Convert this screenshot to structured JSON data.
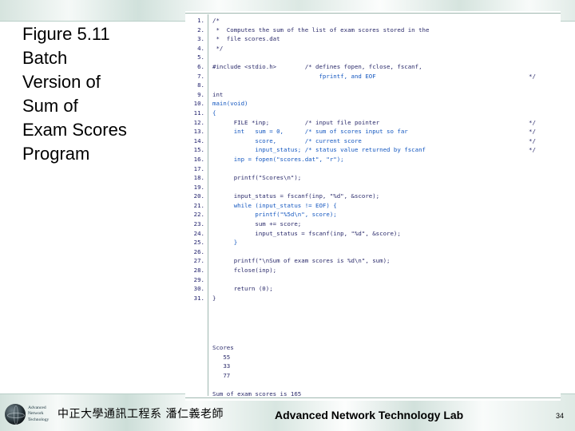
{
  "slide": {
    "title": "Figure 5.11\nBatch\nVersion of\nSum of\nExam Scores\nProgram",
    "page_number": "34"
  },
  "footer": {
    "chinese": "中正大學通訊工程系 潘仁義老師",
    "english": "Advanced Network Technology Lab",
    "logo_text": "Advanced\nNetwork\nTechnology"
  },
  "figure": {
    "code_lines": [
      {
        "n": "1.",
        "text": "/*",
        "right": ""
      },
      {
        "n": "2.",
        "text": " *  Computes the sum of the list of exam scores stored in the",
        "right": ""
      },
      {
        "n": "3.",
        "text": " *  file scores.dat",
        "right": ""
      },
      {
        "n": "4.",
        "text": " */",
        "right": ""
      },
      {
        "n": "5.",
        "text": "",
        "right": ""
      },
      {
        "n": "6.",
        "text": "#include <stdio.h>        /* defines fopen, fclose, fscanf,",
        "right": ""
      },
      {
        "n": "7.",
        "text": "                              fprintf, and EOF",
        "right": "*/"
      },
      {
        "n": "8.",
        "text": "",
        "right": ""
      },
      {
        "n": "9.",
        "text": "int",
        "right": ""
      },
      {
        "n": "10.",
        "text": "main(void)",
        "right": ""
      },
      {
        "n": "11.",
        "text": "{",
        "right": ""
      },
      {
        "n": "12.",
        "text": "      FILE *inp;          /* input file pointer",
        "right": "*/"
      },
      {
        "n": "13.",
        "text": "      int   sum = 0,      /* sum of scores input so far",
        "right": "*/"
      },
      {
        "n": "14.",
        "text": "            score,        /* current score",
        "right": "*/"
      },
      {
        "n": "15.",
        "text": "            input_status; /* status value returned by fscanf",
        "right": "*/"
      },
      {
        "n": "16.",
        "text": "      inp = fopen(\"scores.dat\", \"r\");",
        "right": ""
      },
      {
        "n": "17.",
        "text": "",
        "right": ""
      },
      {
        "n": "18.",
        "text": "      printf(\"Scores\\n\");",
        "right": ""
      },
      {
        "n": "19.",
        "text": "",
        "right": ""
      },
      {
        "n": "20.",
        "text": "      input_status = fscanf(inp, \"%d\", &score);",
        "right": ""
      },
      {
        "n": "21.",
        "text": "      while (input_status != EOF) {",
        "right": ""
      },
      {
        "n": "22.",
        "text": "            printf(\"%5d\\n\", score);",
        "right": ""
      },
      {
        "n": "23.",
        "text": "            sum += score;",
        "right": ""
      },
      {
        "n": "24.",
        "text": "            input_status = fscanf(inp, \"%d\", &score);",
        "right": ""
      },
      {
        "n": "25.",
        "text": "      }",
        "right": ""
      },
      {
        "n": "26.",
        "text": "",
        "right": ""
      },
      {
        "n": "27.",
        "text": "      printf(\"\\nSum of exam scores is %d\\n\", sum);",
        "right": ""
      },
      {
        "n": "28.",
        "text": "      fclose(inp);",
        "right": ""
      },
      {
        "n": "29.",
        "text": "",
        "right": ""
      },
      {
        "n": "30.",
        "text": "      return (0);",
        "right": ""
      },
      {
        "n": "31.",
        "text": "}",
        "right": ""
      }
    ],
    "output_text": "Scores\n   55\n   33\n   77\n\nSum of exam scores is 165"
  }
}
